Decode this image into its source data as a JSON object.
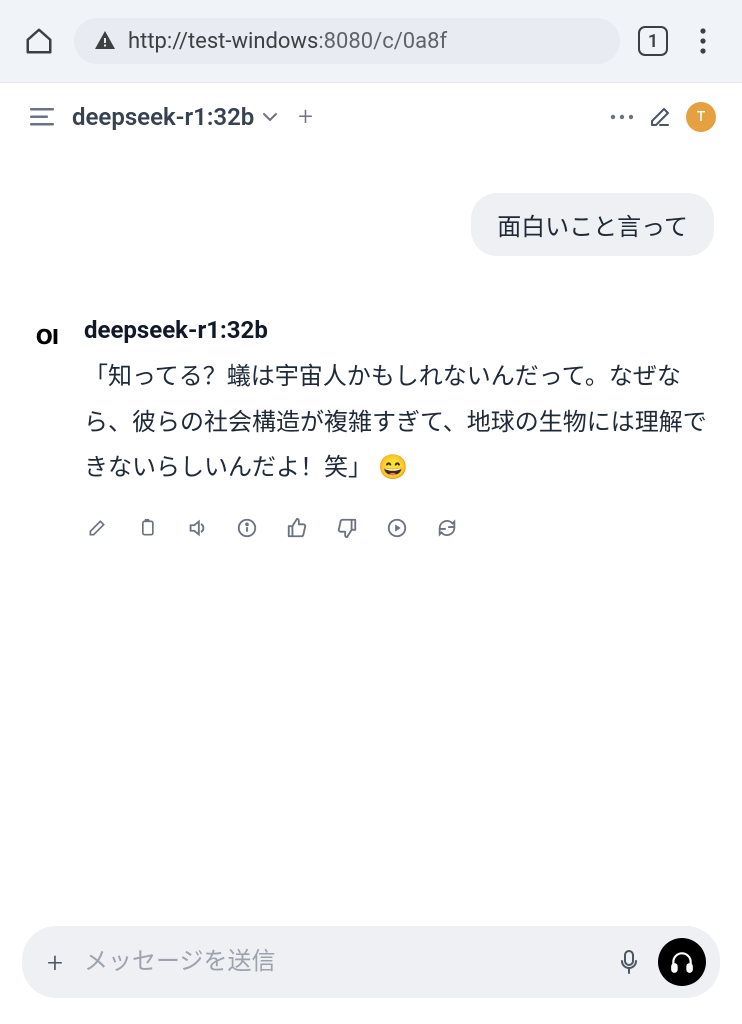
{
  "browser": {
    "url_scheme": "http://",
    "url_host": "test-windows",
    "url_port": ":8080",
    "url_path": "/c/0a8f",
    "tab_count": "1"
  },
  "header": {
    "model": "deepseek-r1:32b",
    "avatar_initial": "T"
  },
  "chat": {
    "user_message": "面白いこと言って",
    "assistant": {
      "name": "deepseek-r1:32b",
      "avatar_text": "OI",
      "text": "「知ってる？蟻は宇宙人かもしれないんだって。なぜなら、彼らの社会構造が複雑すぎて、地球の生物には理解できないらしいんだよ！笑」 😄"
    }
  },
  "input": {
    "placeholder": "メッセージを送信"
  }
}
